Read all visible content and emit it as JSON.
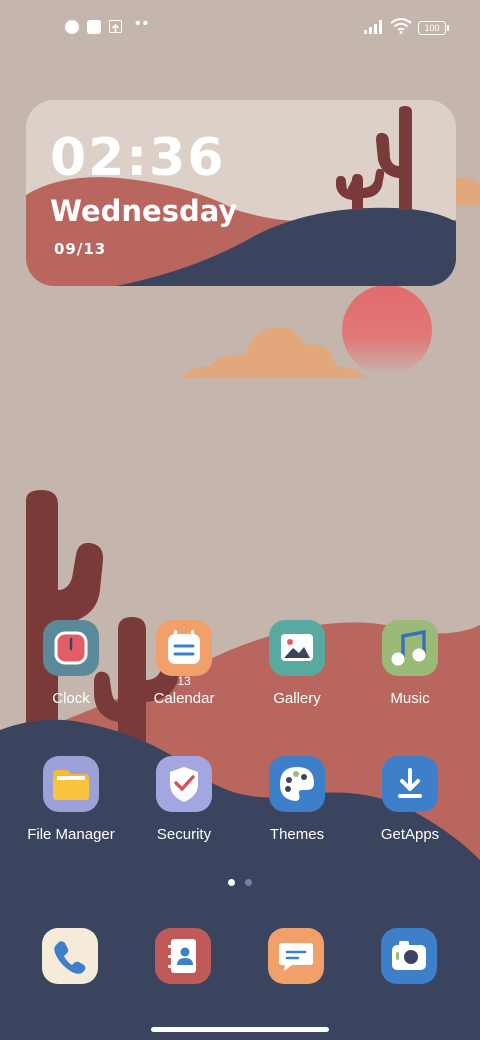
{
  "status_bar": {
    "left_icons": [
      "pinwheel-icon",
      "square-app-icon",
      "upload-icon",
      "more-dots-icon"
    ],
    "battery": "100",
    "right_icons": [
      "signal-icon",
      "wifi-icon",
      "battery-icon"
    ]
  },
  "widget": {
    "time": "02:36",
    "day": "Wednesday",
    "date": "09/13"
  },
  "apps_row1": [
    {
      "label": "Clock",
      "icon": "clock-icon",
      "color": "#5a8a9a"
    },
    {
      "label": "Calendar",
      "icon": "calendar-icon",
      "color": "#f2a06a",
      "badge": "13"
    },
    {
      "label": "Gallery",
      "icon": "gallery-icon",
      "color": "#58aaa1"
    },
    {
      "label": "Music",
      "icon": "music-icon",
      "color": "#9bb977"
    }
  ],
  "apps_row2": [
    {
      "label": "File Manager",
      "icon": "folder-icon",
      "color": "#9aa2d8"
    },
    {
      "label": "Security",
      "icon": "shield-check-icon",
      "color": "#a3a6e0"
    },
    {
      "label": "Themes",
      "icon": "palette-icon",
      "color": "#3d7fc9"
    },
    {
      "label": "GetApps",
      "icon": "download-icon",
      "color": "#3d7fc9"
    }
  ],
  "pager": {
    "pages": 2,
    "active": 1
  },
  "dock": [
    {
      "name": "phone",
      "icon": "phone-icon",
      "color": "#f6ead8"
    },
    {
      "name": "contacts",
      "icon": "contacts-icon",
      "color": "#c05a58"
    },
    {
      "name": "messages",
      "icon": "message-icon",
      "color": "#f2a06a"
    },
    {
      "name": "camera",
      "icon": "camera-icon",
      "color": "#3d7fc9"
    }
  ]
}
